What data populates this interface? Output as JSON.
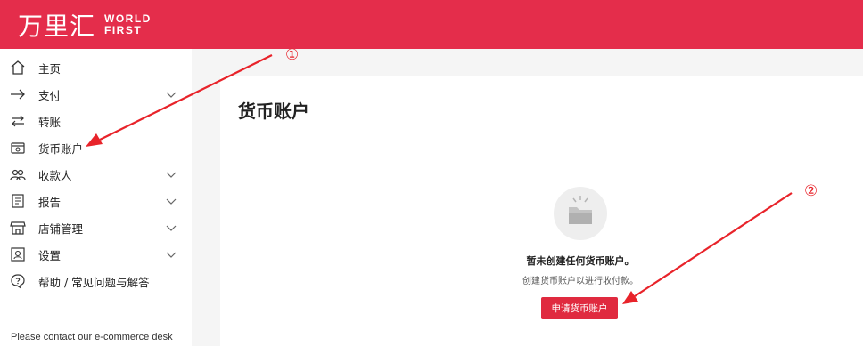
{
  "brand": {
    "name_cn": "万里汇",
    "name_en_line1": "WORLD",
    "name_en_line2": "FIRST"
  },
  "sidebar": {
    "items": [
      {
        "label": "主页",
        "icon": "home-icon",
        "expandable": false
      },
      {
        "label": "支付",
        "icon": "arrow-right-icon",
        "expandable": true
      },
      {
        "label": "转账",
        "icon": "transfer-icon",
        "expandable": false
      },
      {
        "label": "货币账户",
        "icon": "wallet-icon",
        "expandable": false
      },
      {
        "label": "收款人",
        "icon": "users-icon",
        "expandable": true
      },
      {
        "label": "报告",
        "icon": "report-icon",
        "expandable": true
      },
      {
        "label": "店铺管理",
        "icon": "store-icon",
        "expandable": true
      },
      {
        "label": "设置",
        "icon": "settings-icon",
        "expandable": true
      },
      {
        "label": "帮助 / 常见问题与解答",
        "icon": "help-icon",
        "expandable": false
      }
    ],
    "footer_text": "Please contact our e-commerce desk"
  },
  "main": {
    "title": "货币账户",
    "empty_title": "暂未创建任何货币账户。",
    "empty_desc": "创建货币账户以进行收付款。",
    "apply_button": "申请货币账户"
  },
  "annotations": {
    "marker1": "①",
    "marker2": "②"
  },
  "colors": {
    "brand": "#e42d4b",
    "button": "#e02a3f",
    "annotation": "#e8232a"
  }
}
